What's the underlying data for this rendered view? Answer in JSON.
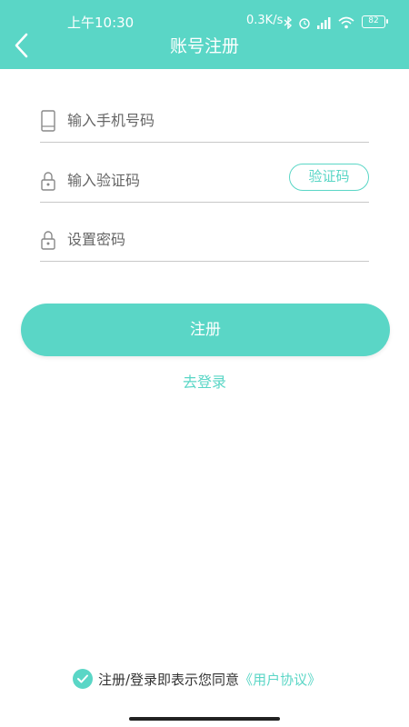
{
  "status_bar": {
    "time": "上午10:30",
    "network_speed": "0.3K/s",
    "battery": "82",
    "icons": [
      "bluetooth-icon",
      "alarm-icon",
      "signal-icon",
      "wifi-icon"
    ]
  },
  "header": {
    "title": "账号注册",
    "back_icon": "back-arrow-icon",
    "background_color": "#5ad6c6"
  },
  "form": {
    "phone": {
      "placeholder": "输入手机号码",
      "value": "",
      "icon": "phone-icon"
    },
    "code": {
      "placeholder": "输入验证码",
      "value": "",
      "icon": "lock-icon",
      "button_label": "验证码"
    },
    "password": {
      "placeholder": "设置密码",
      "value": "",
      "icon": "lock-icon"
    }
  },
  "actions": {
    "register_label": "注册",
    "login_link": "去登录"
  },
  "agreement": {
    "checked": true,
    "text": "注册/登录即表示您同意",
    "link": "《用户协议》"
  },
  "colors": {
    "accent": "#5ad6c6",
    "text": "#333333",
    "divider": "#c8c8c8"
  }
}
